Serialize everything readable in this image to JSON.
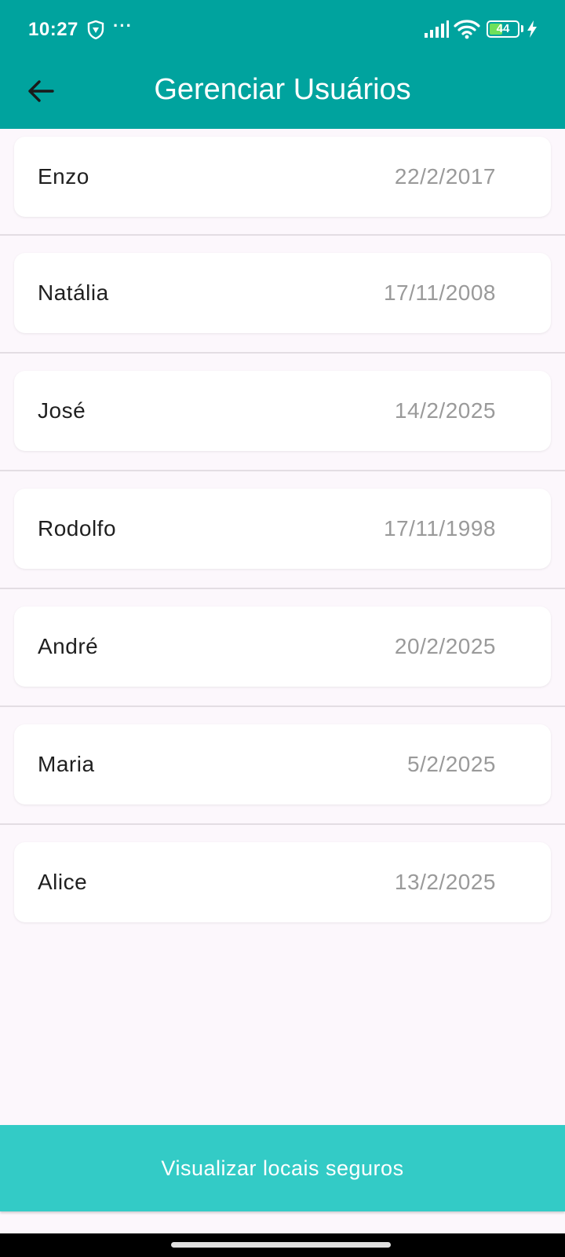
{
  "status_bar": {
    "time": "10:27",
    "more_dots": "···",
    "battery_level": "44",
    "icons": [
      "shield-icon",
      "signal-icon",
      "wifi-icon",
      "battery-icon",
      "charging-icon"
    ]
  },
  "app_bar": {
    "title": "Gerenciar Usuários",
    "back_icon": "arrow-back-icon"
  },
  "users": [
    {
      "name": "Enzo",
      "date": "22/2/2017"
    },
    {
      "name": "Natália",
      "date": "17/11/2008"
    },
    {
      "name": "José",
      "date": "14/2/2025"
    },
    {
      "name": "Rodolfo",
      "date": "17/11/1998"
    },
    {
      "name": "André",
      "date": "20/2/2025"
    },
    {
      "name": "Maria",
      "date": "5/2/2025"
    },
    {
      "name": "Alice",
      "date": "13/2/2025"
    }
  ],
  "bottom_button": {
    "label": "Visualizar locais seguros"
  },
  "colors": {
    "header": "#00a39e",
    "button": "#33cbc6",
    "background": "#fcf7fc"
  }
}
